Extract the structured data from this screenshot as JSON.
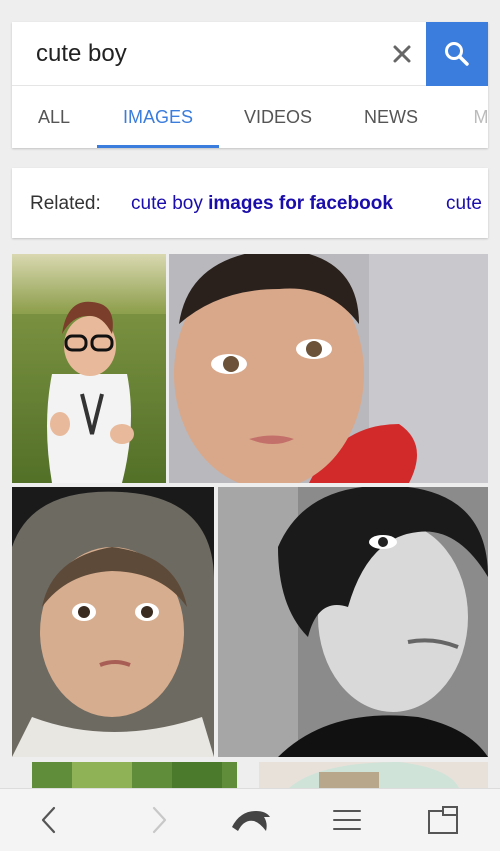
{
  "search": {
    "query": "cute boy",
    "clear_icon": "close-icon",
    "submit_icon": "search-icon"
  },
  "tabs": [
    {
      "label": "ALL"
    },
    {
      "label": "IMAGES",
      "active": true
    },
    {
      "label": "VIDEOS"
    },
    {
      "label": "NEWS"
    },
    {
      "label": "M"
    }
  ],
  "related": {
    "label": "Related:",
    "suggestion_plain": "cute boy ",
    "suggestion_bold": "images for facebook",
    "next_suggestion": "cute"
  },
  "results": [
    {
      "subject": "toddler-with-glasses"
    },
    {
      "subject": "child-closeup"
    },
    {
      "subject": "baby-in-hood"
    },
    {
      "subject": "teen-black-and-white"
    },
    {
      "subject": "partial-image"
    },
    {
      "subject": "partial-image"
    }
  ],
  "toolbar": {
    "back_icon": "chevron-left-icon",
    "forward_icon": "chevron-right-icon",
    "home_icon": "dolphin-icon",
    "menu_icon": "menu-icon",
    "tabs_icon": "tabs-icon"
  },
  "colors": {
    "accent": "#3b7ddd",
    "link": "#1a0dab"
  }
}
